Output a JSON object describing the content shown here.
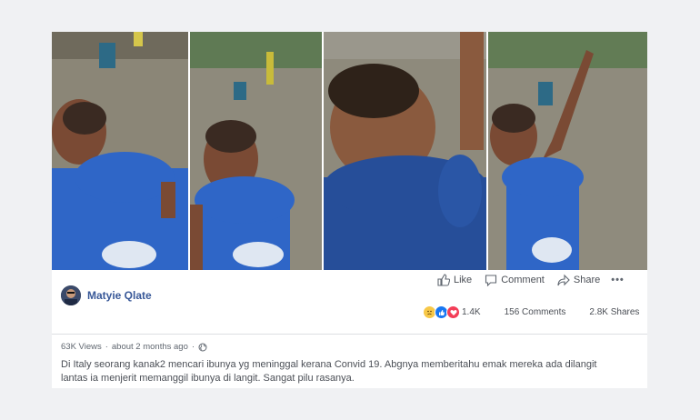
{
  "poster": {
    "name": "Matyie Qlate"
  },
  "actions": {
    "like": "Like",
    "comment": "Comment",
    "share": "Share",
    "more": "•••"
  },
  "stats": {
    "reactions_count": "1.4K",
    "comments": "156 Comments",
    "shares": "2.8K Shares"
  },
  "meta": {
    "views": "63K Views",
    "separator": "·",
    "time": "about 2 months ago"
  },
  "caption": {
    "line1": "Di Italy seorang kanak2 mencari ibunya yg meninggal kerana Convid 19. Abgnya memberitahu emak mereka ada dilangit",
    "line2": "lantas ia menjerit memanggil ibunya di langit. Sangat pilu rasanya."
  },
  "colors": {
    "poster_name": "#385898",
    "like_reaction": "#1877f2",
    "love_reaction": "#f33e58",
    "sad_reaction": "#f7c848",
    "shirt_blue": "#2f66c7",
    "ground": "#8a8576"
  },
  "icons": {
    "like": "thumbs-up-icon",
    "comment": "speech-bubble-icon",
    "share": "share-arrow-icon",
    "privacy": "globe-icon"
  }
}
